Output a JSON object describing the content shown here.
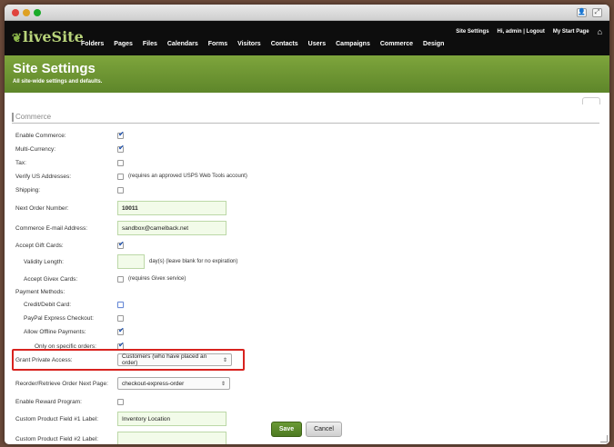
{
  "titlebar": {
    "icons": [
      "close-icon",
      "minimize-icon",
      "zoom-icon"
    ]
  },
  "app": {
    "logo_text": "liveSite"
  },
  "utility": {
    "site_settings": "Site Settings",
    "greeting": "Hi, admin | Logout",
    "my_start_page": "My Start Page",
    "home_icon": "⌂"
  },
  "nav": [
    "Folders",
    "Pages",
    "Files",
    "Calendars",
    "Forms",
    "Visitors",
    "Contacts",
    "Users",
    "Campaigns",
    "Commerce",
    "Design"
  ],
  "header": {
    "title": "Site Settings",
    "subtitle": "All site-wide settings and defaults."
  },
  "section": {
    "title": "Commerce"
  },
  "fields": {
    "enable_commerce": {
      "label": "Enable Commerce:",
      "checked": true
    },
    "multi_currency": {
      "label": "Multi-Currency:",
      "checked": true
    },
    "tax": {
      "label": "Tax:",
      "checked": false
    },
    "verify_us": {
      "label": "Verify US Addresses:",
      "checked": false,
      "hint": "(requires an approved USPS Web Tools account)"
    },
    "shipping": {
      "label": "Shipping:",
      "checked": false
    },
    "next_order": {
      "label": "Next Order Number:",
      "value": "10011"
    },
    "commerce_email": {
      "label": "Commerce E-mail Address:",
      "value": "sandbox@camelback.net"
    },
    "gift_cards": {
      "label": "Accept Gift Cards:",
      "checked": true
    },
    "validity": {
      "label": "Validity Length:",
      "value": "",
      "hint": "day(s) (leave blank for no expiration)"
    },
    "givex": {
      "label": "Accept Givex Cards:",
      "checked": false,
      "hint": "(requires Givex service)"
    },
    "payment_methods": {
      "label": "Payment Methods:"
    },
    "credit_card": {
      "label": "Credit/Debit Card:",
      "checked": false
    },
    "paypal": {
      "label": "PayPal Express Checkout:",
      "checked": false
    },
    "offline": {
      "label": "Allow Offline Payments:",
      "checked": true
    },
    "specific_orders": {
      "label": "Only on specific orders:",
      "checked": true
    },
    "grant_private": {
      "label": "Grant Private Access:",
      "value": "Customers (who have placed an order)"
    },
    "reorder_page": {
      "label": "Reorder/Retrieve Order Next Page:",
      "value": "checkout-express-order"
    },
    "reward": {
      "label": "Enable Reward Program:",
      "checked": false
    },
    "custom1": {
      "label": "Custom Product Field #1 Label:",
      "value": "Inventory Location"
    },
    "custom2": {
      "label": "Custom Product Field #2 Label:",
      "value": ""
    }
  },
  "buttons": {
    "save": "Save",
    "cancel": "Cancel"
  }
}
